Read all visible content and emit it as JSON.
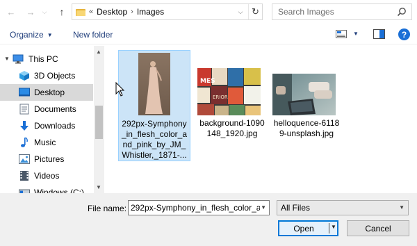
{
  "address_bar": {
    "breadcrumb": [
      "Desktop",
      "Images"
    ],
    "overflow_marker": "«",
    "search_placeholder": "Search Images"
  },
  "toolbar": {
    "organize_label": "Organize",
    "new_folder_label": "New folder",
    "help_label": "?"
  },
  "nav_pane": {
    "items": [
      {
        "label": "This PC",
        "icon": "pc-icon"
      },
      {
        "label": "3D Objects",
        "icon": "cube-3d-icon"
      },
      {
        "label": "Desktop",
        "icon": "desktop-icon",
        "selected": true
      },
      {
        "label": "Documents",
        "icon": "documents-icon"
      },
      {
        "label": "Downloads",
        "icon": "download-arrow-icon"
      },
      {
        "label": "Music",
        "icon": "music-note-icon"
      },
      {
        "label": "Pictures",
        "icon": "pictures-icon"
      },
      {
        "label": "Videos",
        "icon": "videos-icon"
      },
      {
        "label": "Windows (C:)",
        "icon": "drive-icon"
      }
    ]
  },
  "files": [
    {
      "name": "292px-Symphony_in_flesh_color_and_pink_by_JM_Whistler,_1871-...",
      "selected": true,
      "thumb": "painting-woman-thumbnail"
    },
    {
      "name": "background-1090148_1920.jpg",
      "selected": false,
      "thumb": "magazine-rack-thumbnail"
    },
    {
      "name": "helloquence-61189-unsplash.jpg",
      "selected": false,
      "thumb": "laptop-desk-thumbnail"
    }
  ],
  "bottom": {
    "file_name_label": "File name:",
    "file_name_value": "292px-Symphony_in_flesh_color_a",
    "file_type_value": "All Files",
    "open_label": "Open",
    "cancel_label": "Cancel"
  },
  "colors": {
    "accent": "#0078d7",
    "selection_bg": "#cce4f7",
    "link_text": "#1f3d7a",
    "nav_selected": "#d9d9d9"
  }
}
